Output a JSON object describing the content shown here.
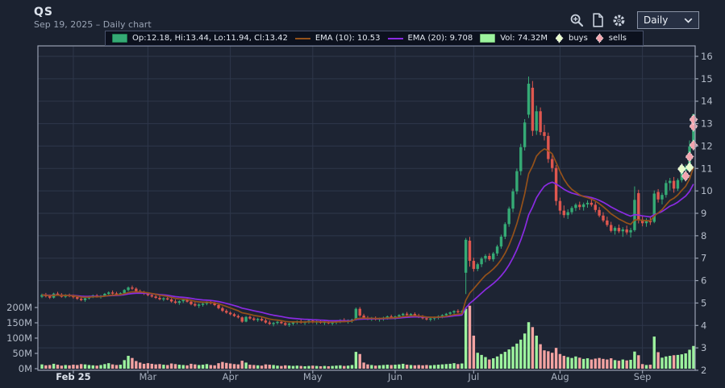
{
  "header": {
    "symbol": "QS",
    "subtitle": "Sep 19, 2025 – Daily chart"
  },
  "toolbar": {
    "icons": [
      "zoom-in-icon",
      "document-icon",
      "gear-icon"
    ],
    "period_value": "Daily"
  },
  "legend": {
    "ohlc": "Op:12.18, Hi:13.44, Lo:11.94, Cl:13.42",
    "ema10": "EMA (10): 10.53",
    "ema20": "EMA (20): 9.708",
    "vol": "Vol: 74.32M",
    "buys": "buys",
    "sells": "sells"
  },
  "colors": {
    "bg": "#1b2230",
    "plot_bg": "#1d2433",
    "grid": "#2e374b",
    "frame": "#99a1b2",
    "axis_text": "#b4bcc9",
    "month_text": "#a6afbe",
    "year_marker_text": "#dde3ec",
    "candle_up": "#35aa75",
    "candle_down": "#df574f",
    "vol_up": "#9df39e",
    "vol_down": "#f4a3a2",
    "ema10": "#94511a",
    "ema20": "#8a2be2",
    "buy": "#e7fccb",
    "sell": "#f3a4ae"
  },
  "chart_data": {
    "type": "candlestick",
    "title": "QS — daily OHLC with EMA(10), EMA(20), volume and trade markers",
    "price_axis": {
      "min": 2,
      "max": 16,
      "tick_step": 1,
      "tick_labels": [
        "2",
        "3",
        "4",
        "5",
        "6",
        "7",
        "8",
        "9",
        "10",
        "11",
        "12",
        "13",
        "14",
        "15",
        "16"
      ]
    },
    "volume_axis": {
      "ticks": [
        {
          "v": 0,
          "label": "0M"
        },
        {
          "v": 50,
          "label": "50M"
        },
        {
          "v": 100,
          "label": "100M"
        },
        {
          "v": 150,
          "label": "150M"
        },
        {
          "v": 200,
          "label": "200M"
        }
      ]
    },
    "month_ticks": [
      {
        "i": 8,
        "label": "Feb 25",
        "year_marker": true
      },
      {
        "i": 27,
        "label": "Mar",
        "year_marker": false
      },
      {
        "i": 48,
        "label": "Apr",
        "year_marker": false
      },
      {
        "i": 69,
        "label": "May",
        "year_marker": false
      },
      {
        "i": 90,
        "label": "Jun",
        "year_marker": false
      },
      {
        "i": 110,
        "label": "Jul",
        "year_marker": false
      },
      {
        "i": 132,
        "label": "Aug",
        "year_marker": false
      },
      {
        "i": 153,
        "label": "Sep",
        "year_marker": false
      }
    ],
    "overlays": [
      {
        "name": "EMA (10)",
        "period": 10,
        "current": 10.53
      },
      {
        "name": "EMA (20)",
        "period": 20,
        "current": 9.708
      }
    ],
    "current_volume_M": 74.32,
    "candles_format": [
      "open",
      "high",
      "low",
      "close",
      "volume_M"
    ],
    "candles": [
      [
        5.28,
        5.42,
        5.22,
        5.36,
        14
      ],
      [
        5.36,
        5.45,
        5.25,
        5.3,
        11
      ],
      [
        5.3,
        5.38,
        5.18,
        5.24,
        12
      ],
      [
        5.24,
        5.46,
        5.2,
        5.42,
        16
      ],
      [
        5.42,
        5.5,
        5.32,
        5.38,
        13
      ],
      [
        5.38,
        5.44,
        5.24,
        5.28,
        10
      ],
      [
        5.28,
        5.4,
        5.22,
        5.35,
        12
      ],
      [
        5.35,
        5.42,
        5.26,
        5.31,
        11
      ],
      [
        5.31,
        5.38,
        5.2,
        5.26,
        13
      ],
      [
        5.26,
        5.32,
        5.14,
        5.19,
        12
      ],
      [
        5.19,
        5.28,
        5.08,
        5.13,
        15
      ],
      [
        5.13,
        5.24,
        5.05,
        5.21,
        14
      ],
      [
        5.21,
        5.33,
        5.16,
        5.29,
        12
      ],
      [
        5.29,
        5.38,
        5.22,
        5.34,
        11
      ],
      [
        5.34,
        5.4,
        5.24,
        5.28,
        10
      ],
      [
        5.28,
        5.36,
        5.2,
        5.32,
        12
      ],
      [
        5.32,
        5.45,
        5.28,
        5.41,
        15
      ],
      [
        5.41,
        5.52,
        5.35,
        5.47,
        18
      ],
      [
        5.47,
        5.56,
        5.38,
        5.43,
        14
      ],
      [
        5.43,
        5.5,
        5.34,
        5.39,
        12
      ],
      [
        5.39,
        5.48,
        5.32,
        5.44,
        13
      ],
      [
        5.44,
        5.62,
        5.4,
        5.58,
        28
      ],
      [
        5.58,
        5.74,
        5.52,
        5.69,
        42
      ],
      [
        5.69,
        5.78,
        5.58,
        5.64,
        35
      ],
      [
        5.64,
        5.7,
        5.48,
        5.53,
        25
      ],
      [
        5.53,
        5.6,
        5.42,
        5.47,
        20
      ],
      [
        5.47,
        5.54,
        5.36,
        5.41,
        16
      ],
      [
        5.41,
        5.48,
        5.3,
        5.35,
        18
      ],
      [
        5.35,
        5.42,
        5.24,
        5.29,
        16
      ],
      [
        5.29,
        5.36,
        5.18,
        5.23,
        14
      ],
      [
        5.23,
        5.32,
        5.12,
        5.17,
        15
      ],
      [
        5.17,
        5.26,
        5.08,
        5.21,
        13
      ],
      [
        5.21,
        5.3,
        5.12,
        5.16,
        12
      ],
      [
        5.16,
        5.22,
        5.02,
        5.07,
        17
      ],
      [
        5.07,
        5.16,
        4.96,
        5.01,
        15
      ],
      [
        5.01,
        5.12,
        4.92,
        5.08,
        13
      ],
      [
        5.08,
        5.18,
        5.0,
        5.14,
        12
      ],
      [
        5.14,
        5.2,
        5.02,
        5.06,
        11
      ],
      [
        5.06,
        5.12,
        4.9,
        4.95,
        16
      ],
      [
        4.95,
        5.04,
        4.84,
        4.89,
        14
      ],
      [
        4.89,
        4.98,
        4.78,
        4.93,
        12
      ],
      [
        4.93,
        5.02,
        4.84,
        4.97,
        13
      ],
      [
        4.97,
        5.08,
        4.9,
        5.04,
        15
      ],
      [
        5.04,
        5.12,
        4.94,
        4.99,
        12
      ],
      [
        4.99,
        5.05,
        4.86,
        4.91,
        11
      ],
      [
        4.91,
        4.96,
        4.72,
        4.77,
        18
      ],
      [
        4.77,
        4.84,
        4.6,
        4.65,
        22
      ],
      [
        4.65,
        4.72,
        4.52,
        4.57,
        19
      ],
      [
        4.57,
        4.63,
        4.45,
        4.5,
        17
      ],
      [
        4.5,
        4.56,
        4.38,
        4.42,
        15
      ],
      [
        4.42,
        4.49,
        4.31,
        4.36,
        14
      ],
      [
        4.36,
        4.4,
        4.12,
        4.17,
        26
      ],
      [
        4.17,
        4.42,
        4.14,
        4.38,
        20
      ],
      [
        4.38,
        4.44,
        4.26,
        4.31,
        13
      ],
      [
        4.31,
        4.38,
        4.2,
        4.25,
        12
      ],
      [
        4.25,
        4.34,
        4.16,
        4.29,
        11
      ],
      [
        4.29,
        4.36,
        4.18,
        4.22,
        10
      ],
      [
        4.22,
        4.3,
        4.08,
        4.13,
        14
      ],
      [
        4.13,
        4.22,
        4.02,
        4.07,
        13
      ],
      [
        4.07,
        4.16,
        3.96,
        4.11,
        12
      ],
      [
        4.11,
        4.2,
        4.04,
        4.16,
        10
      ],
      [
        4.16,
        4.24,
        4.06,
        4.1,
        9
      ],
      [
        4.1,
        4.18,
        3.98,
        4.03,
        11
      ],
      [
        4.03,
        4.12,
        3.94,
        4.08,
        10
      ],
      [
        4.08,
        4.17,
        4.0,
        4.13,
        9
      ],
      [
        4.13,
        4.22,
        4.05,
        4.18,
        10
      ],
      [
        4.18,
        4.26,
        4.08,
        4.12,
        9
      ],
      [
        4.12,
        4.2,
        4.02,
        4.16,
        8
      ],
      [
        4.16,
        4.25,
        4.08,
        4.21,
        9
      ],
      [
        4.21,
        4.28,
        4.1,
        4.14,
        10
      ],
      [
        4.14,
        4.22,
        4.04,
        4.18,
        9
      ],
      [
        4.18,
        4.26,
        4.08,
        4.12,
        8
      ],
      [
        4.12,
        4.2,
        4.02,
        4.16,
        9
      ],
      [
        4.16,
        4.24,
        4.06,
        4.1,
        8
      ],
      [
        4.1,
        4.18,
        4.0,
        4.14,
        9
      ],
      [
        4.14,
        4.23,
        4.05,
        4.19,
        10
      ],
      [
        4.19,
        4.28,
        4.1,
        4.24,
        11
      ],
      [
        4.24,
        4.32,
        4.14,
        4.18,
        9
      ],
      [
        4.18,
        4.27,
        4.08,
        4.22,
        10
      ],
      [
        4.22,
        4.3,
        4.12,
        4.26,
        12
      ],
      [
        4.26,
        4.8,
        4.22,
        4.74,
        55
      ],
      [
        4.74,
        4.82,
        4.38,
        4.44,
        48
      ],
      [
        4.44,
        4.52,
        4.3,
        4.35,
        20
      ],
      [
        4.35,
        4.42,
        4.24,
        4.29,
        14
      ],
      [
        4.29,
        4.38,
        4.2,
        4.33,
        12
      ],
      [
        4.33,
        4.4,
        4.22,
        4.27,
        10
      ],
      [
        4.27,
        4.35,
        4.17,
        4.31,
        11
      ],
      [
        4.31,
        4.39,
        4.21,
        4.35,
        12
      ],
      [
        4.35,
        4.44,
        4.26,
        4.4,
        13
      ],
      [
        4.4,
        4.48,
        4.3,
        4.34,
        12
      ],
      [
        4.34,
        4.44,
        4.26,
        4.4,
        13
      ],
      [
        4.4,
        4.5,
        4.32,
        4.46,
        14
      ],
      [
        4.46,
        4.56,
        4.38,
        4.52,
        16
      ],
      [
        4.52,
        4.6,
        4.42,
        4.47,
        13
      ],
      [
        4.47,
        4.55,
        4.37,
        4.51,
        12
      ],
      [
        4.51,
        4.58,
        4.4,
        4.44,
        11
      ],
      [
        4.44,
        4.52,
        4.33,
        4.38,
        12
      ],
      [
        4.38,
        4.46,
        4.27,
        4.32,
        11
      ],
      [
        4.32,
        4.4,
        4.22,
        4.27,
        12
      ],
      [
        4.27,
        4.36,
        4.18,
        4.31,
        11
      ],
      [
        4.31,
        4.4,
        4.22,
        4.36,
        12
      ],
      [
        4.36,
        4.45,
        4.27,
        4.41,
        13
      ],
      [
        4.41,
        4.5,
        4.32,
        4.46,
        14
      ],
      [
        4.46,
        4.56,
        4.38,
        4.52,
        15
      ],
      [
        4.52,
        4.62,
        4.44,
        4.58,
        16
      ],
      [
        4.58,
        4.68,
        4.5,
        4.64,
        18
      ],
      [
        4.64,
        4.72,
        4.54,
        4.59,
        15
      ],
      [
        4.59,
        4.68,
        4.5,
        4.63,
        17
      ],
      [
        6.35,
        7.9,
        5.4,
        7.82,
        196
      ],
      [
        7.78,
        7.95,
        6.62,
        6.88,
        206
      ],
      [
        6.88,
        7.02,
        6.4,
        6.52,
        108
      ],
      [
        6.52,
        6.8,
        6.42,
        6.73,
        52
      ],
      [
        6.73,
        7.05,
        6.6,
        6.98,
        45
      ],
      [
        6.98,
        7.18,
        6.82,
        7.1,
        38
      ],
      [
        7.1,
        7.22,
        6.88,
        6.95,
        30
      ],
      [
        6.95,
        7.28,
        6.85,
        7.21,
        34
      ],
      [
        7.21,
        7.6,
        7.1,
        7.52,
        40
      ],
      [
        7.52,
        8.05,
        7.42,
        7.96,
        48
      ],
      [
        7.96,
        8.6,
        7.85,
        8.52,
        55
      ],
      [
        8.52,
        9.3,
        8.4,
        9.21,
        63
      ],
      [
        9.21,
        10.1,
        9.05,
        9.98,
        72
      ],
      [
        9.98,
        11.0,
        9.85,
        10.88,
        82
      ],
      [
        10.88,
        12.1,
        10.7,
        11.95,
        95
      ],
      [
        11.95,
        13.2,
        11.8,
        13.05,
        115
      ],
      [
        13.4,
        15.1,
        13.25,
        14.78,
        152
      ],
      [
        14.6,
        14.9,
        12.45,
        12.68,
        136
      ],
      [
        12.68,
        13.8,
        12.5,
        13.55,
        108
      ],
      [
        13.55,
        13.72,
        12.48,
        12.62,
        80
      ],
      [
        12.62,
        12.95,
        12.25,
        12.45,
        60
      ],
      [
        12.45,
        12.6,
        11.25,
        11.42,
        57
      ],
      [
        11.42,
        11.6,
        10.85,
        11.02,
        52
      ],
      [
        11.02,
        11.15,
        9.35,
        9.55,
        68
      ],
      [
        9.55,
        9.7,
        8.95,
        9.12,
        48
      ],
      [
        9.12,
        9.35,
        8.8,
        8.92,
        42
      ],
      [
        8.92,
        9.18,
        8.75,
        9.05,
        38
      ],
      [
        9.05,
        9.32,
        8.95,
        9.24,
        35
      ],
      [
        9.24,
        9.45,
        9.1,
        9.38,
        40
      ],
      [
        9.38,
        9.52,
        9.15,
        9.28,
        36
      ],
      [
        9.28,
        9.48,
        9.12,
        9.4,
        32
      ],
      [
        9.4,
        9.58,
        9.25,
        9.47,
        34
      ],
      [
        9.47,
        9.62,
        9.3,
        9.38,
        30
      ],
      [
        9.38,
        9.5,
        9.05,
        9.15,
        33
      ],
      [
        9.15,
        9.28,
        8.82,
        8.9,
        35
      ],
      [
        8.9,
        9.05,
        8.6,
        8.68,
        32
      ],
      [
        8.68,
        8.85,
        8.4,
        8.48,
        30
      ],
      [
        8.48,
        8.62,
        8.15,
        8.22,
        34
      ],
      [
        8.22,
        8.42,
        8.05,
        8.35,
        28
      ],
      [
        8.35,
        8.5,
        8.12,
        8.2,
        26
      ],
      [
        8.2,
        8.38,
        7.95,
        8.28,
        30
      ],
      [
        8.28,
        8.45,
        8.05,
        8.15,
        27
      ],
      [
        8.15,
        8.35,
        7.92,
        8.25,
        29
      ],
      [
        8.25,
        10.2,
        8.18,
        9.6,
        56
      ],
      [
        9.9,
        10.05,
        8.55,
        8.72,
        44
      ],
      [
        8.72,
        8.88,
        8.42,
        8.56,
        15
      ],
      [
        8.56,
        8.78,
        8.4,
        8.66,
        12
      ],
      [
        8.66,
        8.82,
        8.48,
        8.6,
        13
      ],
      [
        8.62,
        10.02,
        8.56,
        9.88,
        105
      ],
      [
        9.95,
        10.08,
        9.48,
        9.62,
        54
      ],
      [
        9.62,
        9.92,
        9.4,
        9.82,
        36
      ],
      [
        9.82,
        10.48,
        9.7,
        10.35,
        40
      ],
      [
        10.35,
        10.58,
        10.02,
        10.45,
        42
      ],
      [
        10.45,
        10.62,
        9.92,
        10.1,
        44
      ],
      [
        10.1,
        10.56,
        10.0,
        10.48,
        45
      ],
      [
        10.48,
        11.02,
        10.38,
        10.92,
        47
      ],
      [
        10.92,
        11.18,
        10.52,
        11.06,
        50
      ],
      [
        11.06,
        12.25,
        10.98,
        11.98,
        62
      ],
      [
        12.18,
        13.44,
        11.94,
        13.42,
        74.32
      ]
    ],
    "markers": [
      {
        "i": 163,
        "type": "buy",
        "price": 10.98
      },
      {
        "i": 164,
        "type": "sell",
        "price": 10.66
      },
      {
        "i": 165,
        "type": "buy",
        "price": 11.05
      },
      {
        "i": 165,
        "type": "sell",
        "price": 11.52
      },
      {
        "i": 166,
        "type": "sell",
        "price": 12.04
      },
      {
        "i": 166,
        "type": "sell",
        "price": 12.88
      },
      {
        "i": 166,
        "type": "sell",
        "price": 13.18
      }
    ]
  }
}
